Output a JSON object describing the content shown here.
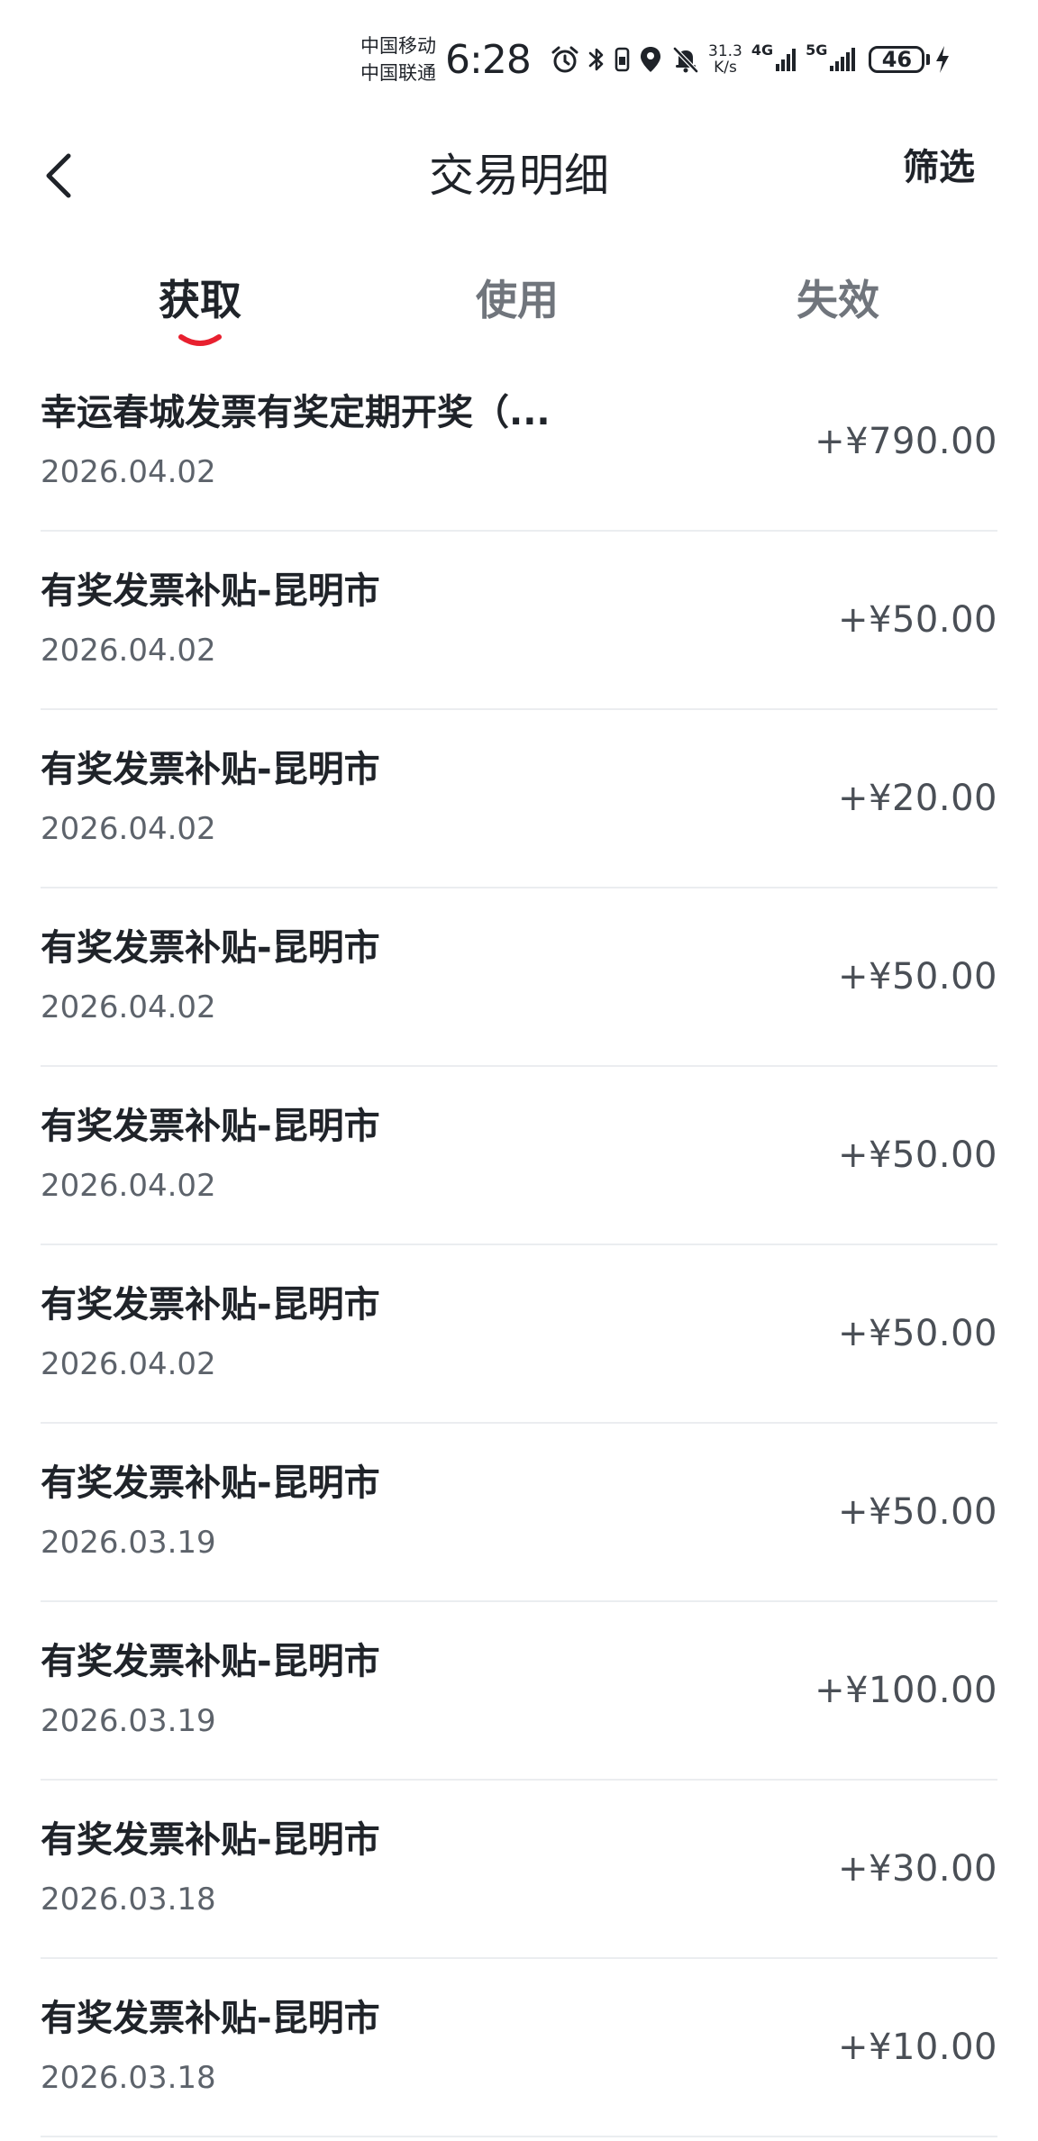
{
  "status_bar": {
    "carrier_1": "中国移动",
    "carrier_2": "中国联通",
    "time": "6:28",
    "net_speed_value": "31.3",
    "net_speed_unit": "K/s",
    "network_1": "4G",
    "network_2": "5G",
    "battery_level": "46",
    "icons": [
      "alarm-icon",
      "bluetooth-icon",
      "vibrate-icon",
      "location-icon",
      "mute-icon",
      "signal-icon",
      "signal-icon",
      "charging-icon"
    ]
  },
  "header": {
    "title": "交易明细",
    "filter_label": "筛选"
  },
  "tabs": [
    {
      "label": "获取",
      "active": true
    },
    {
      "label": "使用",
      "active": false
    },
    {
      "label": "失效",
      "active": false
    }
  ],
  "transactions": [
    {
      "title": "幸运春城发票有奖定期开奖（...",
      "date": "2026.04.02",
      "amount": "+¥790.00"
    },
    {
      "title": "有奖发票补贴-昆明市",
      "date": "2026.04.02",
      "amount": "+¥50.00"
    },
    {
      "title": "有奖发票补贴-昆明市",
      "date": "2026.04.02",
      "amount": "+¥20.00"
    },
    {
      "title": "有奖发票补贴-昆明市",
      "date": "2026.04.02",
      "amount": "+¥50.00"
    },
    {
      "title": "有奖发票补贴-昆明市",
      "date": "2026.04.02",
      "amount": "+¥50.00"
    },
    {
      "title": "有奖发票补贴-昆明市",
      "date": "2026.04.02",
      "amount": "+¥50.00"
    },
    {
      "title": "有奖发票补贴-昆明市",
      "date": "2026.03.19",
      "amount": "+¥50.00"
    },
    {
      "title": "有奖发票补贴-昆明市",
      "date": "2026.03.19",
      "amount": "+¥100.00"
    },
    {
      "title": "有奖发票补贴-昆明市",
      "date": "2026.03.18",
      "amount": "+¥30.00"
    },
    {
      "title": "有奖发票补贴-昆明市",
      "date": "2026.03.18",
      "amount": "+¥10.00"
    }
  ],
  "colors": {
    "accent": "#e8202f",
    "text_primary": "#1f2329",
    "text_secondary": "#5d636b",
    "divider": "#ebedf0"
  }
}
